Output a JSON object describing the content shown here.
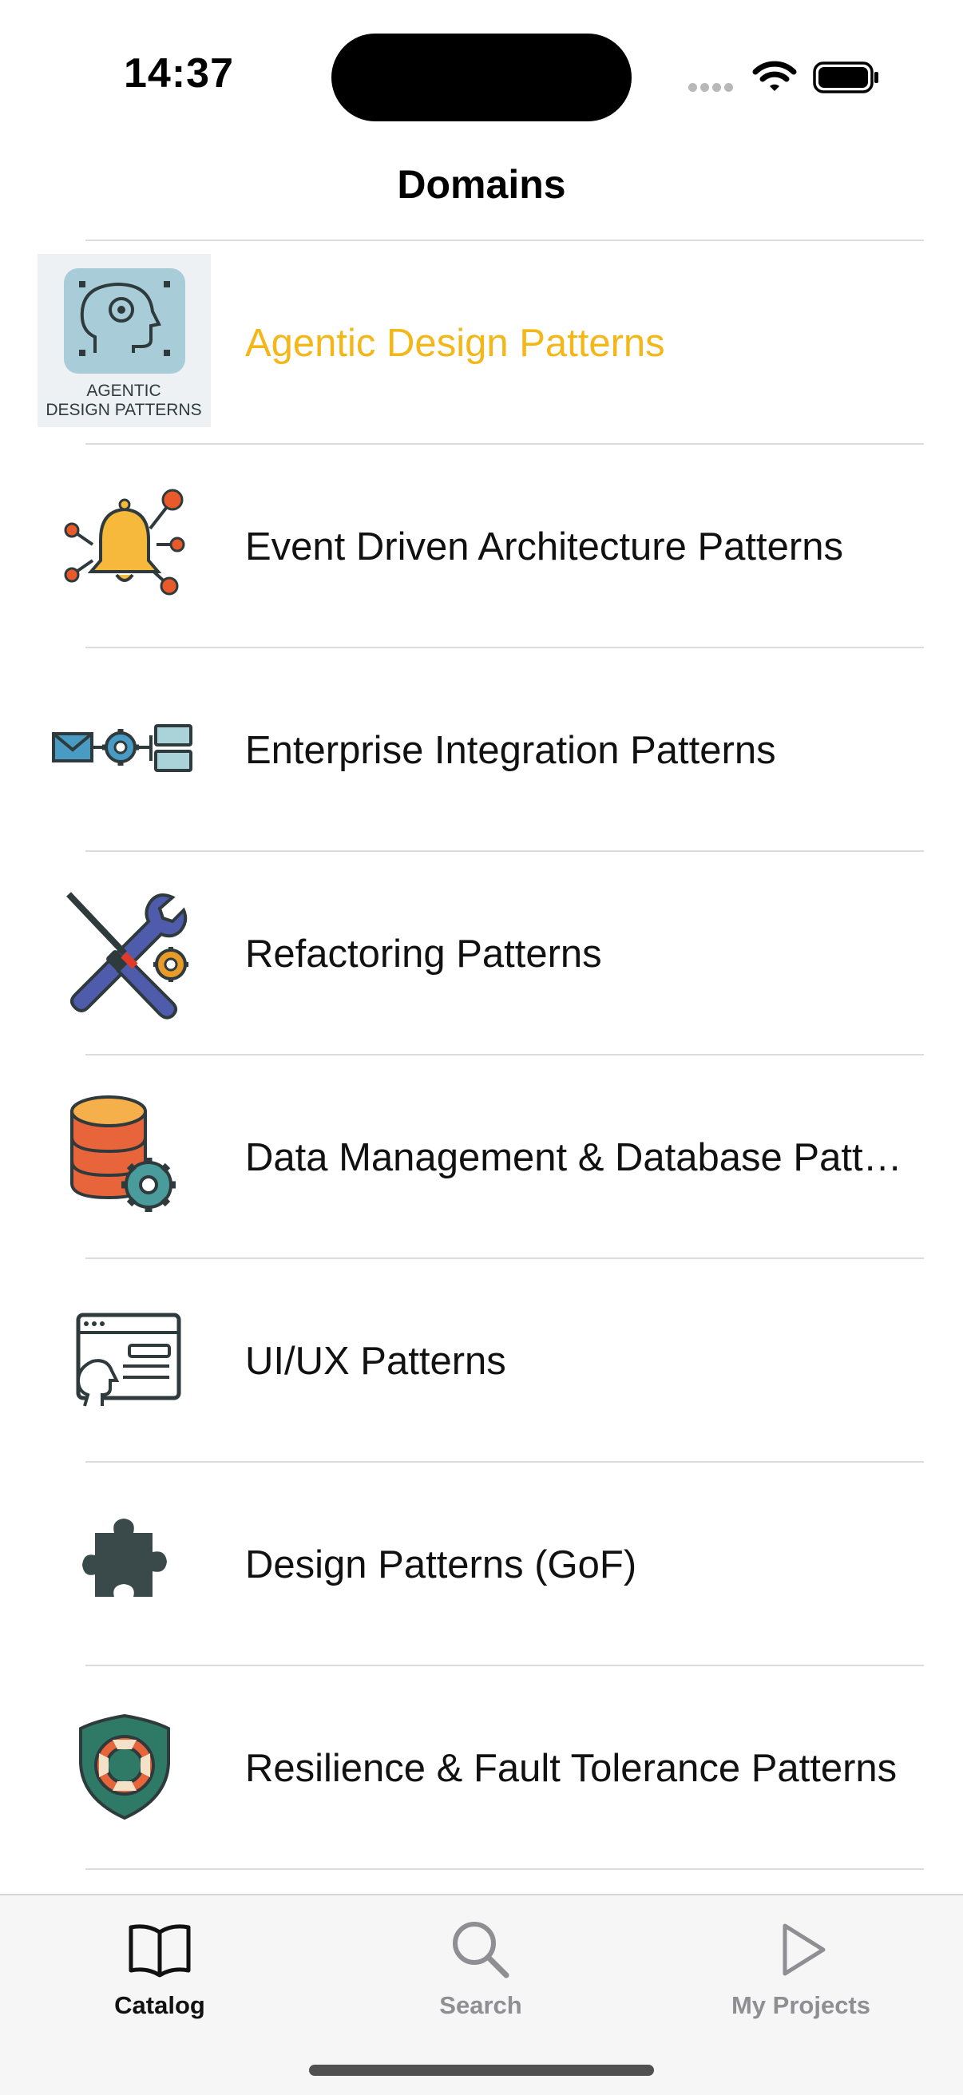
{
  "status": {
    "time": "14:37"
  },
  "nav": {
    "title": "Domains"
  },
  "colors": {
    "accent": "#F3B719",
    "tab_active": "#111111",
    "tab_inactive": "#8E8E93"
  },
  "domains": [
    {
      "label": "Agentic Design Patterns",
      "icon": "agentic-brain-icon",
      "selected": true,
      "thumb_text_1": "AGENTIC",
      "thumb_text_2": "DESIGN PATTERNS"
    },
    {
      "label": "Event Driven Architecture Patterns",
      "icon": "bell-network-icon"
    },
    {
      "label": "Enterprise Integration Patterns",
      "icon": "envelope-gear-icon"
    },
    {
      "label": "Refactoring Patterns",
      "icon": "wrench-screwdriver-icon"
    },
    {
      "label": "Data Management & Database Patt…",
      "icon": "database-gear-icon"
    },
    {
      "label": "UI/UX Patterns",
      "icon": "browser-user-icon"
    },
    {
      "label": "Design Patterns (GoF)",
      "icon": "puzzle-piece-icon"
    },
    {
      "label": "Resilience & Fault Tolerance Patterns",
      "icon": "shield-lifebuoy-icon"
    }
  ],
  "tabs": [
    {
      "label": "Catalog",
      "icon": "book-icon",
      "active": true
    },
    {
      "label": "Search",
      "icon": "magnifier-icon",
      "active": false
    },
    {
      "label": "My Projects",
      "icon": "play-icon",
      "active": false
    }
  ]
}
